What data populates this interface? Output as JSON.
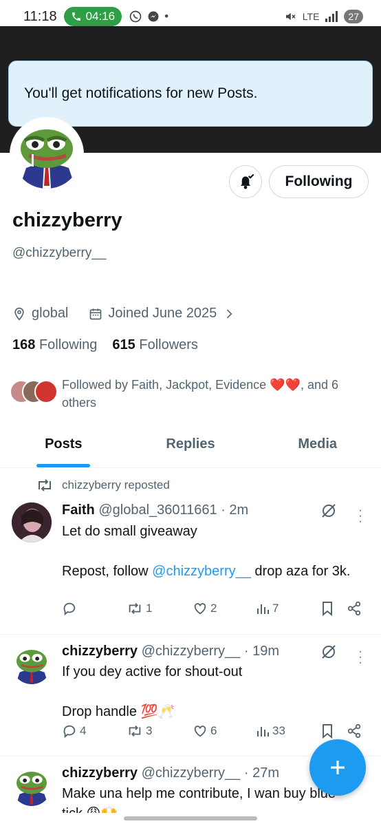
{
  "status_bar": {
    "time": "11:18",
    "call_duration": "04:16",
    "battery": "27",
    "network": "LTE"
  },
  "toast": {
    "text": "You'll get notifications for new Posts."
  },
  "profile": {
    "display_name": "chizzyberry",
    "handle": "@chizzyberry__",
    "location": "global",
    "joined": "Joined June 2025",
    "following_count": "168",
    "following_label": "Following",
    "followers_count": "615",
    "followers_label": "Followers",
    "follow_button": "Following",
    "followed_by": "Followed by Faith, Jackpot, Evidence ❤️❤️, and 6 others"
  },
  "tabs": [
    {
      "label": "Posts",
      "active": true
    },
    {
      "label": "Replies",
      "active": false
    },
    {
      "label": "Media",
      "active": false
    }
  ],
  "posts": [
    {
      "repost_label": "chizzyberry reposted",
      "author": "Faith",
      "handle": "@global_36011661",
      "time": "· 2m",
      "line1": "Let do small giveaway",
      "line2_pre": "Repost, follow ",
      "line2_link": "@chizzyberry__",
      "line2_post": "  drop aza for 3k.",
      "replies": "",
      "reposts": "1",
      "likes": "2",
      "views": "7"
    },
    {
      "author": "chizzyberry",
      "handle": "@chizzyberry__",
      "time": "· 19m",
      "line1": "If you dey active for shout-out",
      "line2": "Drop handle 💯🥂",
      "replies": "4",
      "reposts": "3",
      "likes": "6",
      "views": "33"
    },
    {
      "author": "chizzyberry",
      "handle": "@chizzyberry__",
      "time": "· 27m",
      "line1": "Make una help me contribute, I wan buy blue",
      "line2": "tick 😩🙌"
    }
  ],
  "colors": {
    "accent": "#1d9bf0",
    "toast_bg": "#e0f1fb",
    "call_pill": "#2e9e47",
    "banner": "#1f1f1f"
  }
}
